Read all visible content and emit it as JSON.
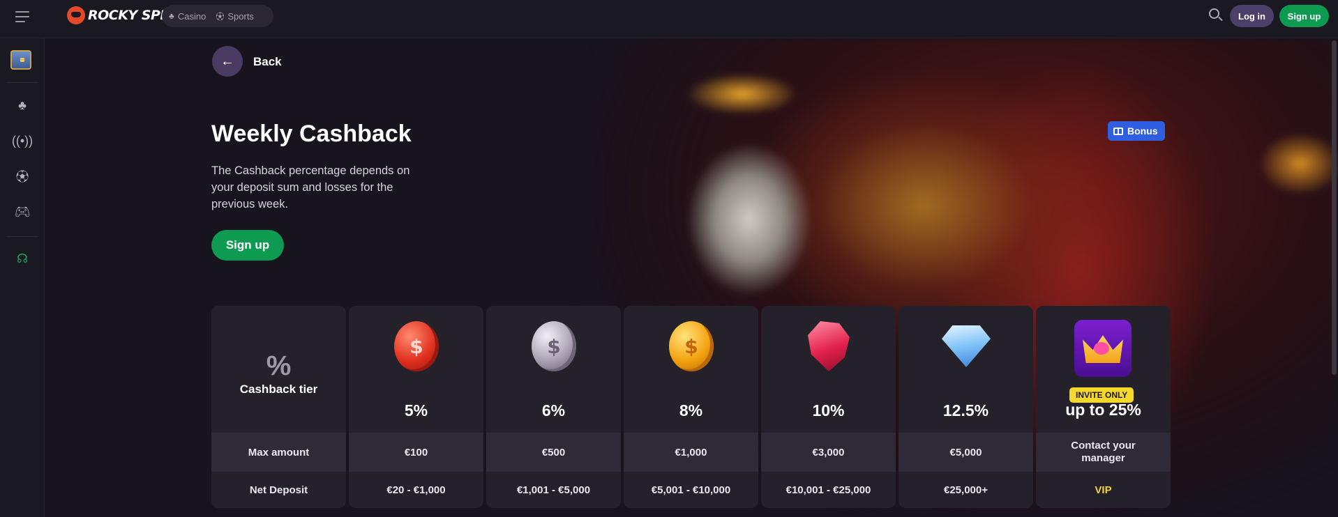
{
  "header": {
    "logo_text": "ROCKY SPIN",
    "nav": [
      {
        "label": "Casino",
        "icon": "cherries-icon"
      },
      {
        "label": "Sports",
        "icon": "soccer-ball-icon"
      }
    ],
    "login_label": "Log in",
    "signup_label": "Sign up"
  },
  "sidebar": {
    "items": [
      {
        "icon": "treasure-chest-icon"
      },
      {
        "icon": "cherries-icon"
      },
      {
        "icon": "live-broadcast-icon"
      },
      {
        "icon": "soccer-ball-icon"
      },
      {
        "icon": "gamepad-icon"
      },
      {
        "icon": "headset-support-icon"
      }
    ]
  },
  "page": {
    "back_label": "Back",
    "bonus_badge": "Bonus",
    "title": "Weekly Cashback",
    "description": "The Cashback percentage depends on your deposit sum and losses for the previous week.",
    "signup_label": "Sign up"
  },
  "tiers": {
    "header_label": "Cashback tier",
    "header_glyph": "%",
    "row_labels": [
      "Max amount",
      "Net Deposit"
    ],
    "columns": [
      {
        "icon": "red-coin-icon",
        "rate": "5%",
        "max_amount": "€100",
        "net_deposit": "€20 - €1,000"
      },
      {
        "icon": "silver-coin-icon",
        "rate": "6%",
        "max_amount": "€500",
        "net_deposit": "€1,001 - €5,000"
      },
      {
        "icon": "gold-coin-icon",
        "rate": "8%",
        "max_amount": "€1,000",
        "net_deposit": "€5,001 - €10,000"
      },
      {
        "icon": "ruby-icon",
        "rate": "10%",
        "max_amount": "€3,000",
        "net_deposit": "€10,001 - €25,000"
      },
      {
        "icon": "diamond-icon",
        "rate": "12.5%",
        "max_amount": "€5,000",
        "net_deposit": "€25,000+"
      },
      {
        "icon": "crown-icon",
        "badge": "INVITE ONLY",
        "rate": "up to 25%",
        "max_amount": "Contact your manager",
        "net_deposit": "VIP"
      }
    ]
  },
  "colors": {
    "accent_green": "#0f9a52",
    "accent_purple": "#4c3f6a",
    "bonus_blue": "#2f5fe0",
    "vip_gold": "#f4d23a"
  }
}
